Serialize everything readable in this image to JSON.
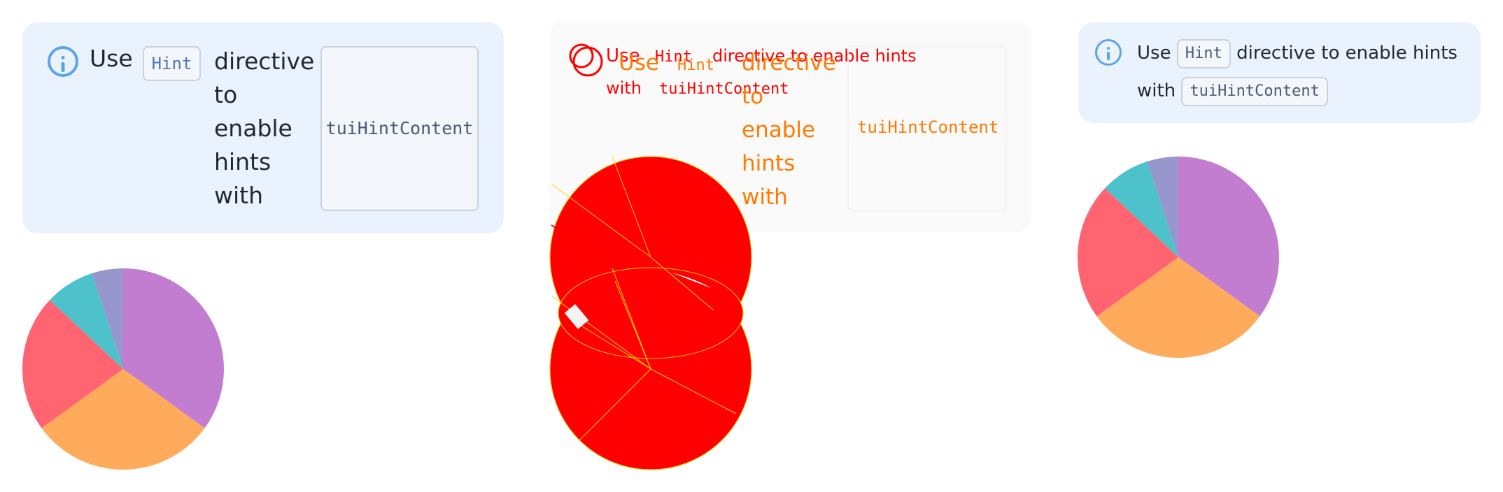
{
  "notice": {
    "use": "Use",
    "hint_chip": "Hint",
    "directive_words": [
      "directive",
      "to",
      "enable",
      "hints",
      "with"
    ],
    "content_chip": "tuiHintContent",
    "full_line1_after_chip": "directive to enable hints",
    "line2_prefix": "with"
  },
  "chart_data": {
    "type": "pie",
    "values": [
      35,
      30,
      22,
      8,
      5
    ],
    "colors": [
      "#c37dd0",
      "#ffab5b",
      "#ff6470",
      "#4ec2ca",
      "#9797cd"
    ]
  },
  "mid_overlay": {
    "line1_parts": [
      "Use",
      "Hint",
      "directive to enable hints"
    ],
    "line2_parts": [
      "with",
      "tuiHintContent"
    ],
    "words": [
      "Use",
      "Hint",
      "directive",
      "to",
      "enable",
      "hints",
      "with"
    ],
    "content_chip": "tuiHintContent",
    "red": "#ff0000",
    "orange": "#ff7a00",
    "yellow": "#ffd200"
  }
}
